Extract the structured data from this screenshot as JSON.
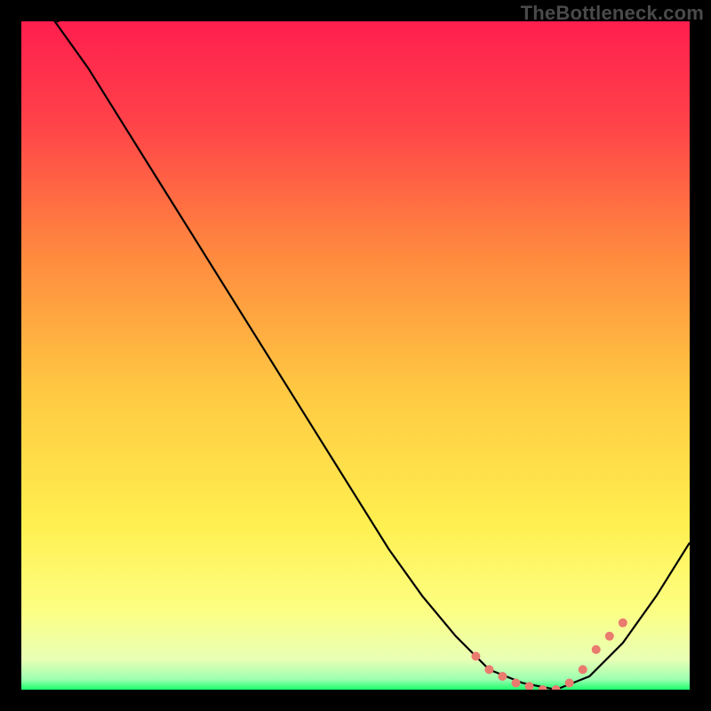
{
  "watermark": "TheBottleneck.com",
  "chart_data": {
    "type": "line",
    "title": "",
    "xlabel": "",
    "ylabel": "",
    "xlim": [
      0,
      100
    ],
    "ylim": [
      0,
      100
    ],
    "grid": false,
    "legend": false,
    "series": [
      {
        "name": "curve",
        "x": [
          5,
          10,
          15,
          20,
          25,
          30,
          35,
          40,
          45,
          50,
          55,
          60,
          65,
          70,
          75,
          80,
          85,
          90,
          95,
          100
        ],
        "y": [
          100,
          93,
          85,
          77,
          69,
          61,
          53,
          45,
          37,
          29,
          21,
          14,
          8,
          3,
          1,
          0,
          2,
          7,
          14,
          22
        ],
        "color": "#000000"
      }
    ],
    "highlight": {
      "name": "highlight-band",
      "color": "#e97b6f",
      "x": [
        68,
        70,
        72,
        74,
        76,
        78,
        80,
        82,
        84,
        86,
        88,
        90
      ],
      "y": [
        5,
        3,
        2,
        1,
        0.5,
        0,
        0,
        1,
        3,
        6,
        8,
        10
      ],
      "point_radius": 5
    },
    "background_gradient": {
      "stops": [
        {
          "offset": 0.0,
          "color": "#ff1e4e"
        },
        {
          "offset": 0.15,
          "color": "#ff4249"
        },
        {
          "offset": 0.35,
          "color": "#ff8a3f"
        },
        {
          "offset": 0.55,
          "color": "#ffc842"
        },
        {
          "offset": 0.75,
          "color": "#ffef4f"
        },
        {
          "offset": 0.88,
          "color": "#fdff82"
        },
        {
          "offset": 0.955,
          "color": "#e8ffb5"
        },
        {
          "offset": 0.985,
          "color": "#9bffb0"
        },
        {
          "offset": 1.0,
          "color": "#1aff6a"
        }
      ]
    }
  }
}
